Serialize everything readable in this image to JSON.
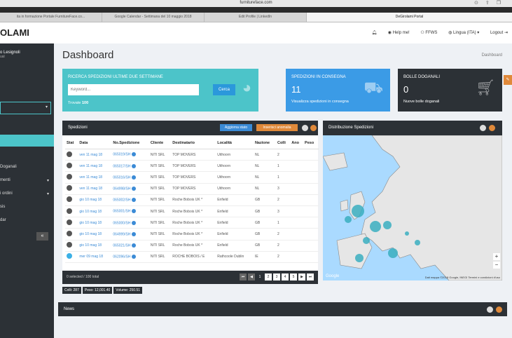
{
  "browser": {
    "url": "furnitureface.com",
    "tabs": [
      {
        "label": "ita in formazione Portale FurnitureFace.co..."
      },
      {
        "label": "Google Calendar - Settimana del 10 maggio 2018"
      },
      {
        "label": "Edit Profile | LinkedIn"
      },
      {
        "label": "DeGirolami Portal"
      }
    ]
  },
  "app": {
    "logo": "OLAMI",
    "nav": {
      "help": "Help me!",
      "ffws": "FFWS",
      "lingua": "Lingua (ITA)",
      "logout": "Logout"
    }
  },
  "sidebar": {
    "user_name": "o Lesignoli",
    "user_sub": "ual",
    "items": [
      {
        "label": "Doganali"
      },
      {
        "label": "menti"
      },
      {
        "label": "i ordini"
      },
      {
        "label": "sis"
      },
      {
        "label": "dar"
      }
    ],
    "collapse": "«"
  },
  "page": {
    "title": "Dashboard",
    "breadcrumb": "Dashboard"
  },
  "cards": {
    "search": {
      "title": "Ricerca spedizioni ultime due settimane",
      "placeholder": "Keyword...",
      "button": "Cerca",
      "found_label": "Trovate",
      "found_count": "100"
    },
    "consegna": {
      "title": "Spedizioni in consegna",
      "count": "11",
      "sub": "Visualizza spedizioni in consegna"
    },
    "bolle": {
      "title": "Bolle doganali",
      "count": "0",
      "sub": "Nuove bolle doganali"
    }
  },
  "shipments": {
    "title": "Spedizioni",
    "btn_update": "Aggiorna stato",
    "btn_anomaly": "Inserisci anomalia",
    "columns": [
      "Stat",
      "Data",
      "No.Spedizione",
      "Cliente",
      "Destinatario",
      "Località",
      "Nazione",
      "Colli",
      "Ano",
      "Peso"
    ],
    "rows": [
      {
        "date": "ven 11 mag 18",
        "no": "065019/SH",
        "client": "NITI SRL",
        "dest": "TOP MOVERS",
        "loc": "Uithoorn",
        "nat": "NL",
        "colli": "2"
      },
      {
        "date": "ven 11 mag 18",
        "no": "065017/SH",
        "client": "NITI SRL",
        "dest": "TOP MOVERS",
        "loc": "Uithoorn",
        "nat": "NL",
        "colli": "1"
      },
      {
        "date": "ven 11 mag 18",
        "no": "065016/SH",
        "client": "NITI SRL",
        "dest": "TOP MOVERS",
        "loc": "Uithoorn",
        "nat": "NL",
        "colli": "1"
      },
      {
        "date": "ven 11 mag 18",
        "no": "064998/SH",
        "client": "NITI SRL",
        "dest": "TOP MOVERS",
        "loc": "Uithoorn",
        "nat": "NL",
        "colli": "3"
      },
      {
        "date": "gio 10 mag 18",
        "no": "065002/SH",
        "client": "NITI SRL",
        "dest": "Roche Bobois UK *",
        "loc": "Enfield",
        "nat": "GB",
        "colli": "2"
      },
      {
        "date": "gio 10 mag 18",
        "no": "065001/SH",
        "client": "NITI SRL",
        "dest": "Roche Bobois UK *",
        "loc": "Enfield",
        "nat": "GB",
        "colli": "3"
      },
      {
        "date": "gio 10 mag 18",
        "no": "065000/SH",
        "client": "NITI SRL",
        "dest": "Roche Bobois UK *",
        "loc": "Enfield",
        "nat": "GB",
        "colli": "1"
      },
      {
        "date": "gio 10 mag 18",
        "no": "064999/SH",
        "client": "NITI SRL",
        "dest": "Roche Bobois UK *",
        "loc": "Enfield",
        "nat": "GB",
        "colli": "2"
      },
      {
        "date": "gio 10 mag 18",
        "no": "065021/SH",
        "client": "NITI SRL",
        "dest": "Roche Bobois UK *",
        "loc": "Enfield",
        "nat": "GB",
        "colli": "2"
      },
      {
        "date": "mer 09 mag 18",
        "no": "062096/SH",
        "client": "NITI SRL",
        "dest": "ROCHE BOBOIS / E",
        "loc": "Rathcoole Dublin",
        "nat": "IE",
        "colli": "2"
      }
    ],
    "footer_info": "0 selected / 100 total",
    "pages": [
      "1",
      "2",
      "3",
      "4",
      "5"
    ]
  },
  "stats": {
    "colli": "Colli: 287",
    "peso": "Peso: 12,001.40",
    "volume": "Volume: 250.51"
  },
  "map": {
    "title": "Distribuzione Spedizioni",
    "google": "Google",
    "footer": "Dati mappa ©2018 Google, INEGI   Termini e condizioni d'uso",
    "zoom_in": "+",
    "zoom_out": "−"
  },
  "news": {
    "title": "News"
  },
  "colors": {
    "teal": "#4cc4c9",
    "blue": "#3b9be6",
    "dark": "#2c3136",
    "orange": "#e0893a"
  }
}
